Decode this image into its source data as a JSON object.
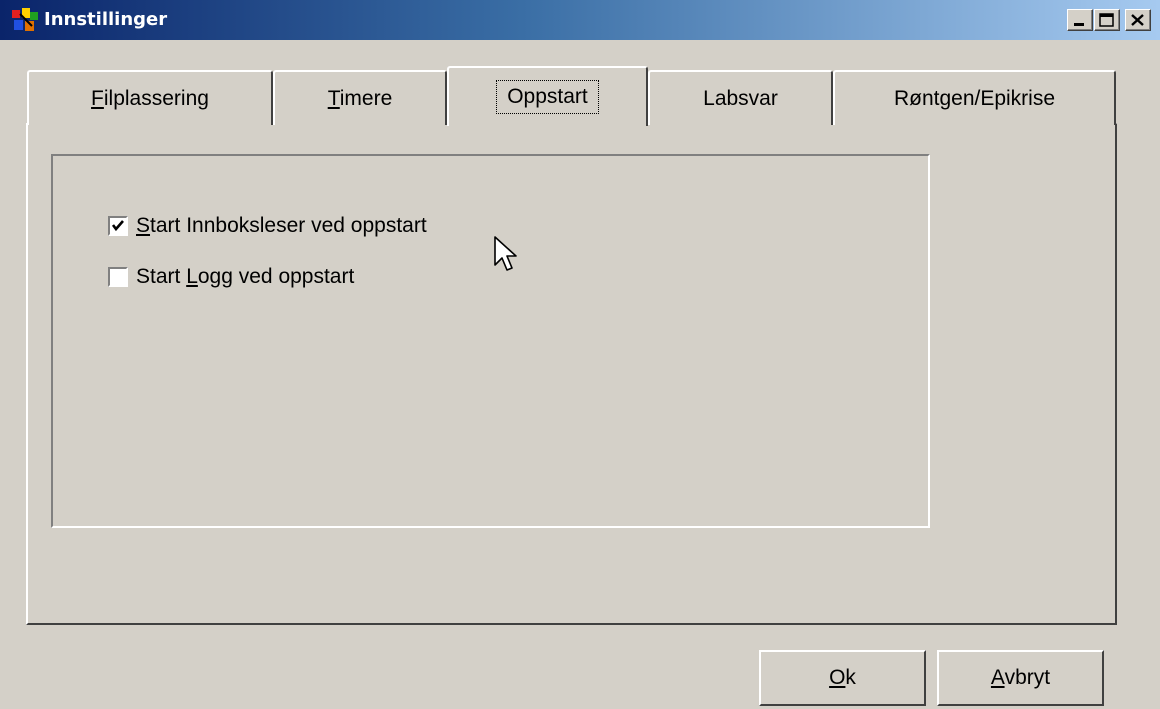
{
  "window": {
    "title": "Innstillinger",
    "app_icon": "app-icon"
  },
  "title_controls": [
    "minimize-icon",
    "maximize-icon",
    "close-icon"
  ],
  "tabs": [
    {
      "label": "Filplassering",
      "accel": "F",
      "rest": "ilplassering",
      "active": false
    },
    {
      "label": "Timere",
      "accel": "T",
      "rest": "imere",
      "active": false
    },
    {
      "label": "Oppstart",
      "accel": "",
      "rest": "Oppstart",
      "active": true
    },
    {
      "label": "Labsvar",
      "accel": "",
      "rest": "Labsvar",
      "active": false
    },
    {
      "label": "Røntgen/Epikrise",
      "accel": "",
      "rest": "Røntgen/Epikrise",
      "active": false
    }
  ],
  "options": [
    {
      "label": "Start Innboksleser ved oppstart",
      "prefix": "",
      "accel": "S",
      "rest": "tart Innboksleser ved oppstart",
      "checked": true
    },
    {
      "label": "Start Logg ved oppstart",
      "prefix": "Start ",
      "accel": "L",
      "rest": "ogg ved oppstart",
      "checked": false
    }
  ],
  "buttons": {
    "ok": {
      "label": "Ok",
      "accel": "O",
      "rest": "k"
    },
    "cancel": {
      "label": "Avbryt",
      "accel": "A",
      "rest": "vbryt"
    }
  },
  "colors": {
    "face": "#d4d0c8",
    "title_start": "#0a246a",
    "title_end": "#a6caf0"
  }
}
